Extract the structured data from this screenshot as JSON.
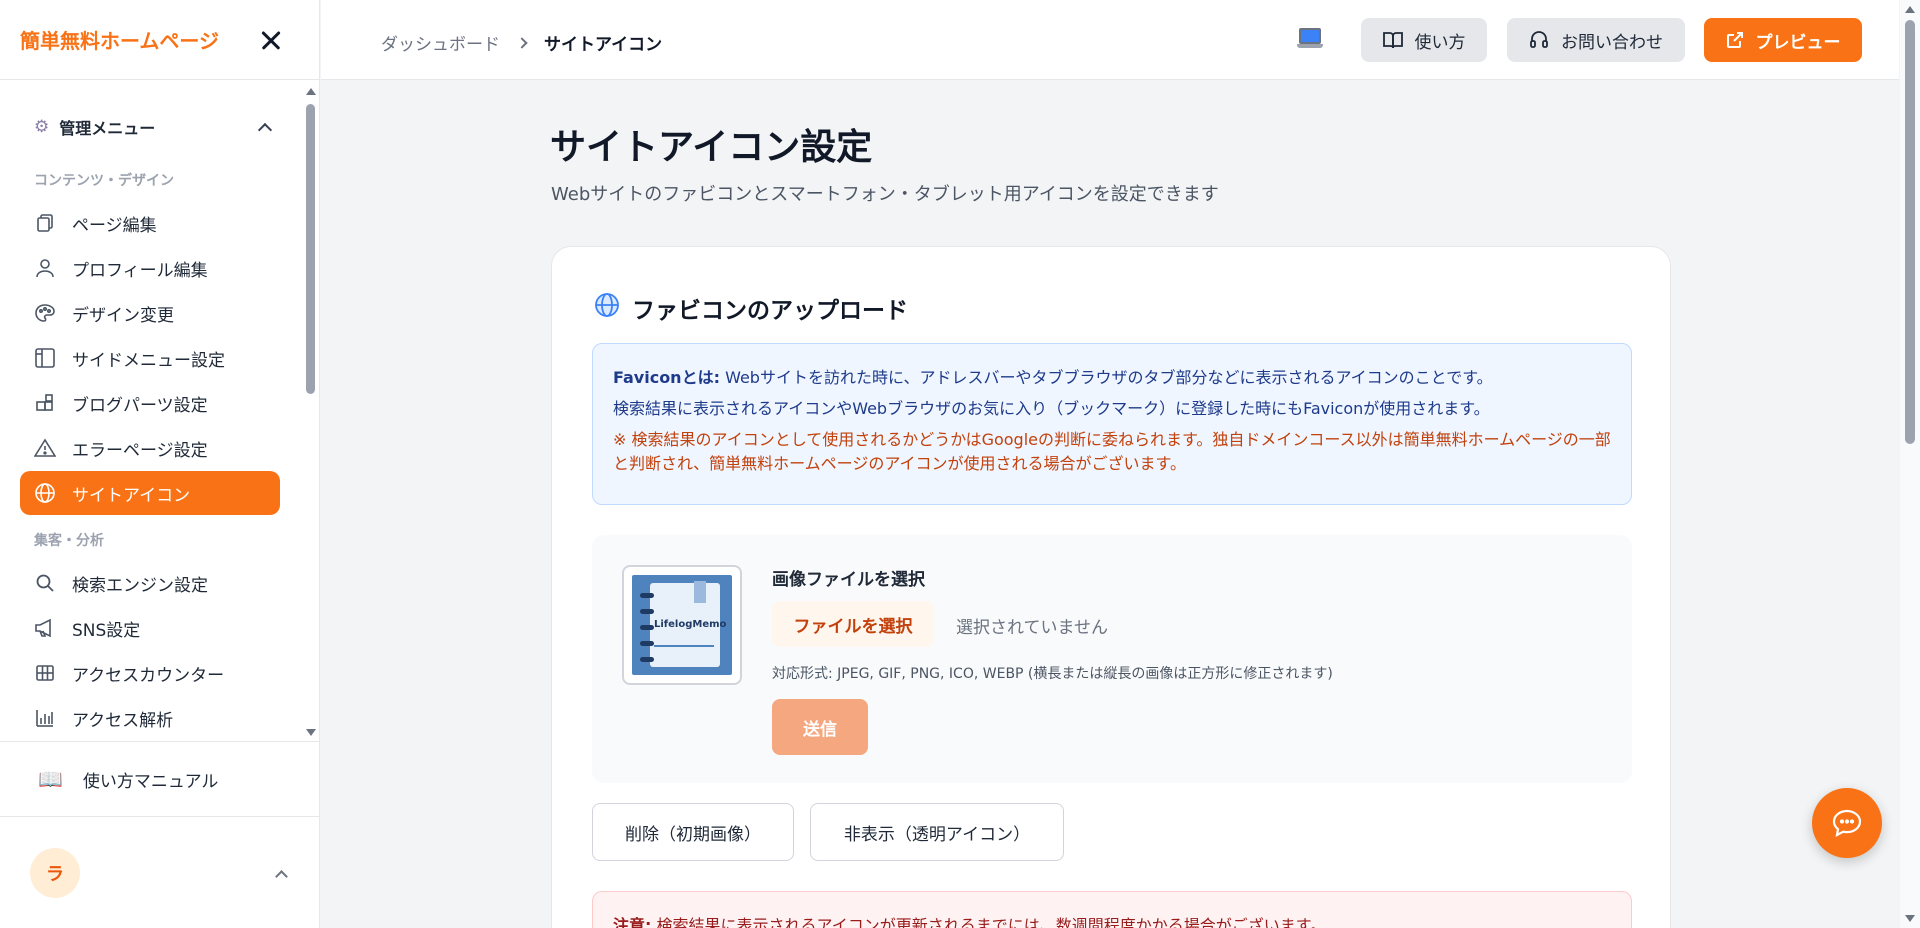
{
  "sidebar": {
    "brand": "簡単無料ホームページ",
    "menu_title": "管理メニュー",
    "sections": {
      "content_design": "コンテンツ・デザイン",
      "marketing": "集客・分析"
    },
    "items": [
      {
        "label": "ページ編集",
        "icon": "pages-icon"
      },
      {
        "label": "プロフィール編集",
        "icon": "user-icon"
      },
      {
        "label": "デザイン変更",
        "icon": "palette-icon"
      },
      {
        "label": "サイドメニュー設定",
        "icon": "layout-icon"
      },
      {
        "label": "ブログパーツ設定",
        "icon": "blocks-icon"
      },
      {
        "label": "エラーページ設定",
        "icon": "warning-icon"
      },
      {
        "label": "サイトアイコン",
        "icon": "globe-icon",
        "active": true
      },
      {
        "label": "検索エンジン設定",
        "icon": "search-icon"
      },
      {
        "label": "SNS設定",
        "icon": "megaphone-icon"
      },
      {
        "label": "アクセスカウンター",
        "icon": "grid-icon"
      },
      {
        "label": "アクセス解析",
        "icon": "bar-chart-icon"
      }
    ],
    "manual": "使い方マニュアル",
    "user_initial": "ラ"
  },
  "header": {
    "breadcrumb": [
      "ダッシュボード",
      "サイトアイコン"
    ],
    "buttons": {
      "howto": "使い方",
      "contact": "お問い合わせ",
      "preview": "プレビュー"
    }
  },
  "main": {
    "title": "サイトアイコン設定",
    "subtitle": "Webサイトのファビコンとスマートフォン・タブレット用アイコンを設定できます",
    "card": {
      "title": "ファビコンのアップロード",
      "info_bold": "Faviconとは:",
      "info_line1": " Webサイトを訪れた時に、アドレスバーやタブブラウザのタブ部分などに表示されるアイコンのことです。",
      "info_line2": "検索結果に表示されるアイコンやWebブラウザのお気に入り（ブックマーク）に登録した時にもFaviconが使用されます。",
      "info_warn": "※ 検索結果のアイコンとして使用されるかどうかはGoogleの判断に委ねられます。独自ドメインコース以外は簡単無料ホームページの一部と判断され、簡単無料ホームページのアイコンが使用される場合がございます。",
      "upload_label": "画像ファイルを選択",
      "file_button": "ファイルを選択",
      "file_status": "選択されていません",
      "formats": "対応形式: JPEG, GIF, PNG, ICO, WEBP (横長または縦長の画像は正方形に修正されます)",
      "submit": "送信",
      "thumb_text": "LifelogMemo",
      "delete_button": "削除（初期画像）",
      "hide_button": "非表示（透明アイコン）",
      "notice_bold": "注意:",
      "notice_text": " 検索結果に表示されるアイコンが更新されるまでには、数週間程度かかる場合がございます。"
    }
  },
  "colors": {
    "accent": "#f97316",
    "info_bg": "#eff6ff",
    "warn_text": "#c2410c"
  }
}
